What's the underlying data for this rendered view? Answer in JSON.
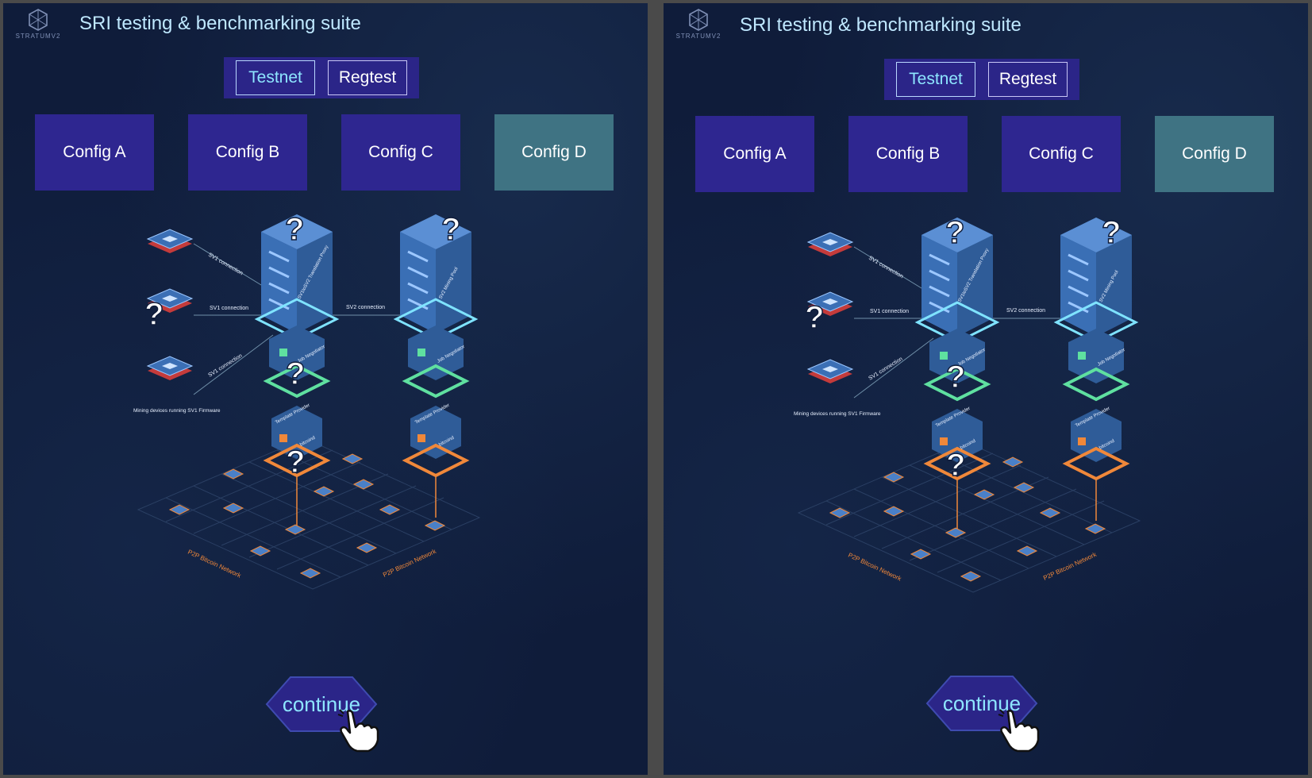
{
  "panels": [
    {
      "logo_text": "STRATUMV2",
      "title": "SRI testing & benchmarking suite",
      "network_tabs": [
        "Testnet",
        "Regtest"
      ],
      "active_network": "Testnet",
      "configs": [
        "Config A",
        "Config B",
        "Config C",
        "Config D"
      ],
      "selected_config": "Config D",
      "continue_label": "continue"
    },
    {
      "logo_text": "STRATUMV2",
      "title": "SRI testing & benchmarking suite",
      "network_tabs": [
        "Testnet",
        "Regtest"
      ],
      "active_network": "Testnet",
      "configs": [
        "Config A",
        "Config B",
        "Config C",
        "Config D"
      ],
      "selected_config": "Config D",
      "continue_label": "continue"
    }
  ],
  "diagram": {
    "sv1_connection": "SV1 connection",
    "sv2_connection": "SV2 connection",
    "proxy_label": "SV1toSV2 Translation Proxy",
    "pool_label": "SV2 Mining Pool",
    "job_negotiator": "Job Negotiator",
    "template_provider": "Template Provider",
    "bitcoind": "bitcoind",
    "mining_devices": "Mining devices running SV1 Firmware",
    "p2p_network": "P2P Bitcoin Network",
    "unknown_marker": "?"
  },
  "colors": {
    "background": "#0f1c3a",
    "button": "#2e2690",
    "selected_config": "#3f7383",
    "accent": "#8ee6ff",
    "green": "#5fe0a0",
    "orange": "#f0883a",
    "red": "#e0504a"
  }
}
